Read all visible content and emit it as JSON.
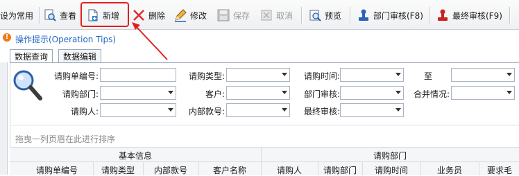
{
  "toolbar": {
    "items": [
      {
        "label": "设为常用",
        "icon": "set-default-icon"
      },
      {
        "label": "查看",
        "icon": "view-icon"
      },
      {
        "label": "新增",
        "icon": "new-document-icon"
      },
      {
        "label": "删除",
        "icon": "delete-x-icon"
      },
      {
        "label": "修改",
        "icon": "edit-pencil-icon"
      },
      {
        "label": "保存",
        "icon": "save-floppy-icon"
      },
      {
        "label": "取消",
        "icon": "cancel-icon"
      },
      {
        "label": "预览",
        "icon": "preview-icon"
      },
      {
        "label": "部门审核(F8)",
        "icon": "dept-approve-stamp-icon"
      },
      {
        "label": "最终审核(F9)",
        "icon": "final-approve-stamp-icon"
      }
    ]
  },
  "tips": {
    "label": "操作提示(Operation Tips)",
    "icon": "info-icon"
  },
  "tabs": [
    {
      "label": "数据查询",
      "active": true
    },
    {
      "label": "数据编辑",
      "active": false
    }
  ],
  "query": {
    "labels": {
      "req_no": "请购单编号:",
      "req_type": "请购类型:",
      "req_time": "请购时间:",
      "to": "至",
      "req_dept": "请购部门:",
      "customer": "客户:",
      "dept_review": "部门审核:",
      "merge_status": "合并情况:",
      "requester": "请购人:",
      "internal_no": "内部款号:",
      "final_review": "最终审核:"
    },
    "values": {
      "req_no": "",
      "req_type": "",
      "req_time": "",
      "req_time_to": "",
      "req_dept": "",
      "customer": "",
      "dept_review": "",
      "merge_status": "",
      "requester": "",
      "internal_no": "",
      "final_review": ""
    }
  },
  "grid": {
    "group_hint": "拖曳一列页眉在此进行排序",
    "bands": [
      {
        "label": "基本信息"
      },
      {
        "label": "请购部门"
      }
    ],
    "columns": [
      "请购单编号",
      "请购类型",
      "内部款号",
      "客户名称",
      "请购人",
      "请购部门",
      "请购时间",
      "业务员",
      "要求毛"
    ]
  },
  "colors": {
    "accent": "#1f65c4",
    "highlight": "#e11f1f",
    "tip": "#f07a13"
  }
}
